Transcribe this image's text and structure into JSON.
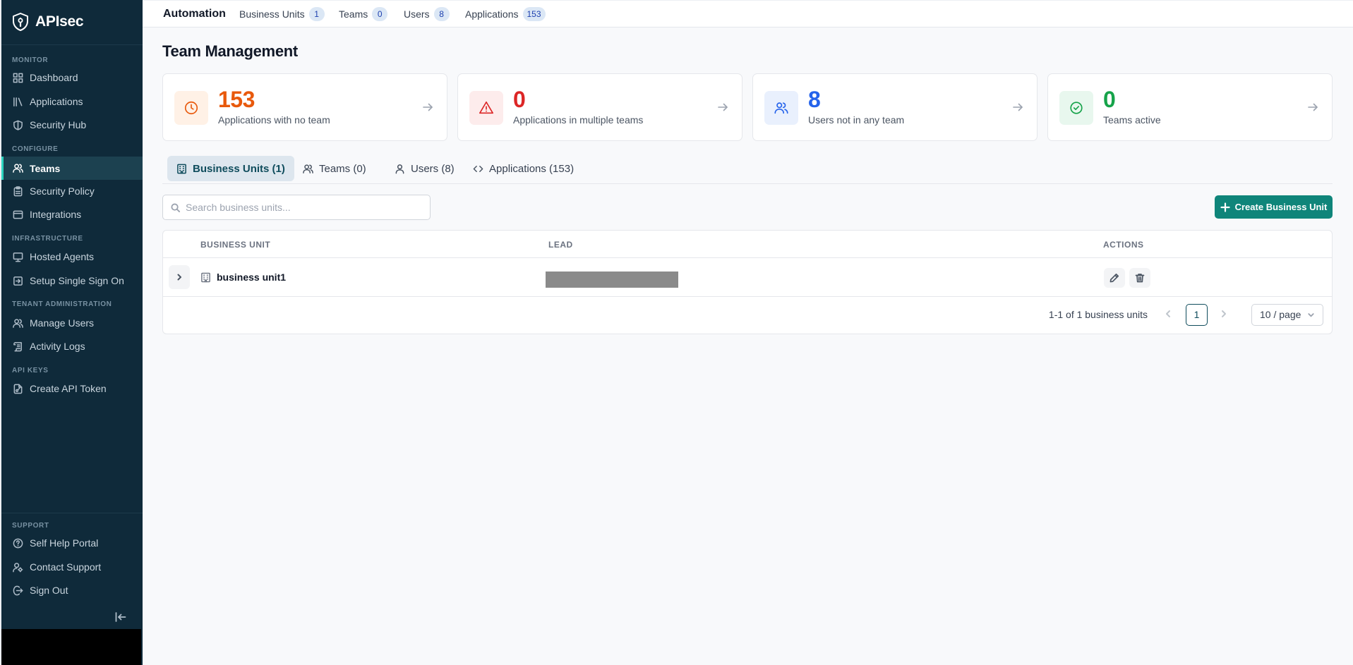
{
  "sidebar": {
    "brand": "APIsec",
    "sections": {
      "monitor": "MONITOR",
      "configure": "CONFIGURE",
      "infrastructure": "INFRASTRUCTURE",
      "tenant_admin": "TENANT ADMINISTRATION",
      "api_keys": "API KEYS",
      "support": "SUPPORT"
    },
    "items": {
      "dashboard": "Dashboard",
      "applications": "Applications",
      "security_hub": "Security Hub",
      "teams": "Teams",
      "security_policy": "Security Policy",
      "integrations": "Integrations",
      "hosted_agents": "Hosted Agents",
      "setup_sso": "Setup Single Sign On",
      "manage_users": "Manage Users",
      "activity_logs": "Activity Logs",
      "create_api_token": "Create API Token",
      "self_help_portal": "Self Help Portal",
      "contact_support": "Contact Support",
      "sign_out": "Sign Out"
    },
    "active_item": "Teams"
  },
  "topbar": {
    "org": "Automation",
    "stats": [
      {
        "label": "Business Units",
        "count": "1"
      },
      {
        "label": "Teams",
        "count": "0"
      },
      {
        "label": "Users",
        "count": "8"
      },
      {
        "label": "Applications",
        "count": "153"
      }
    ]
  },
  "page": {
    "title": "Team Management"
  },
  "cards": [
    {
      "value": "153",
      "label": "Applications with no team",
      "color": "#e8590c",
      "icon": "clock-icon"
    },
    {
      "value": "0",
      "label": "Applications in multiple teams",
      "color": "#dc2626",
      "icon": "alert-triangle-icon"
    },
    {
      "value": "8",
      "label": "Users not in any team",
      "color": "#2563eb",
      "icon": "users-icon"
    },
    {
      "value": "0",
      "label": "Teams active",
      "color": "#16a34a",
      "icon": "check-circle-icon"
    }
  ],
  "tabs": [
    {
      "label": "Business Units (1)",
      "active": true
    },
    {
      "label": "Teams (0)",
      "active": false
    },
    {
      "label": "Users (8)",
      "active": false
    },
    {
      "label": "Applications (153)",
      "active": false
    }
  ],
  "search": {
    "placeholder": "Search business units...",
    "value": ""
  },
  "create_button": "Create Business Unit",
  "table": {
    "columns": [
      "BUSINESS UNIT",
      "LEAD",
      "ACTIONS"
    ],
    "rows": [
      {
        "business_unit": "business unit1",
        "lead": ""
      }
    ]
  },
  "pagination": {
    "total_text": "1-1 of 1 business units",
    "current_page": "1",
    "per_page": "10 / page"
  },
  "colors": {
    "sidebar_bg": "#0f2a3a",
    "accent": "#0f857a",
    "active_indicator": "#2dd4bf"
  }
}
